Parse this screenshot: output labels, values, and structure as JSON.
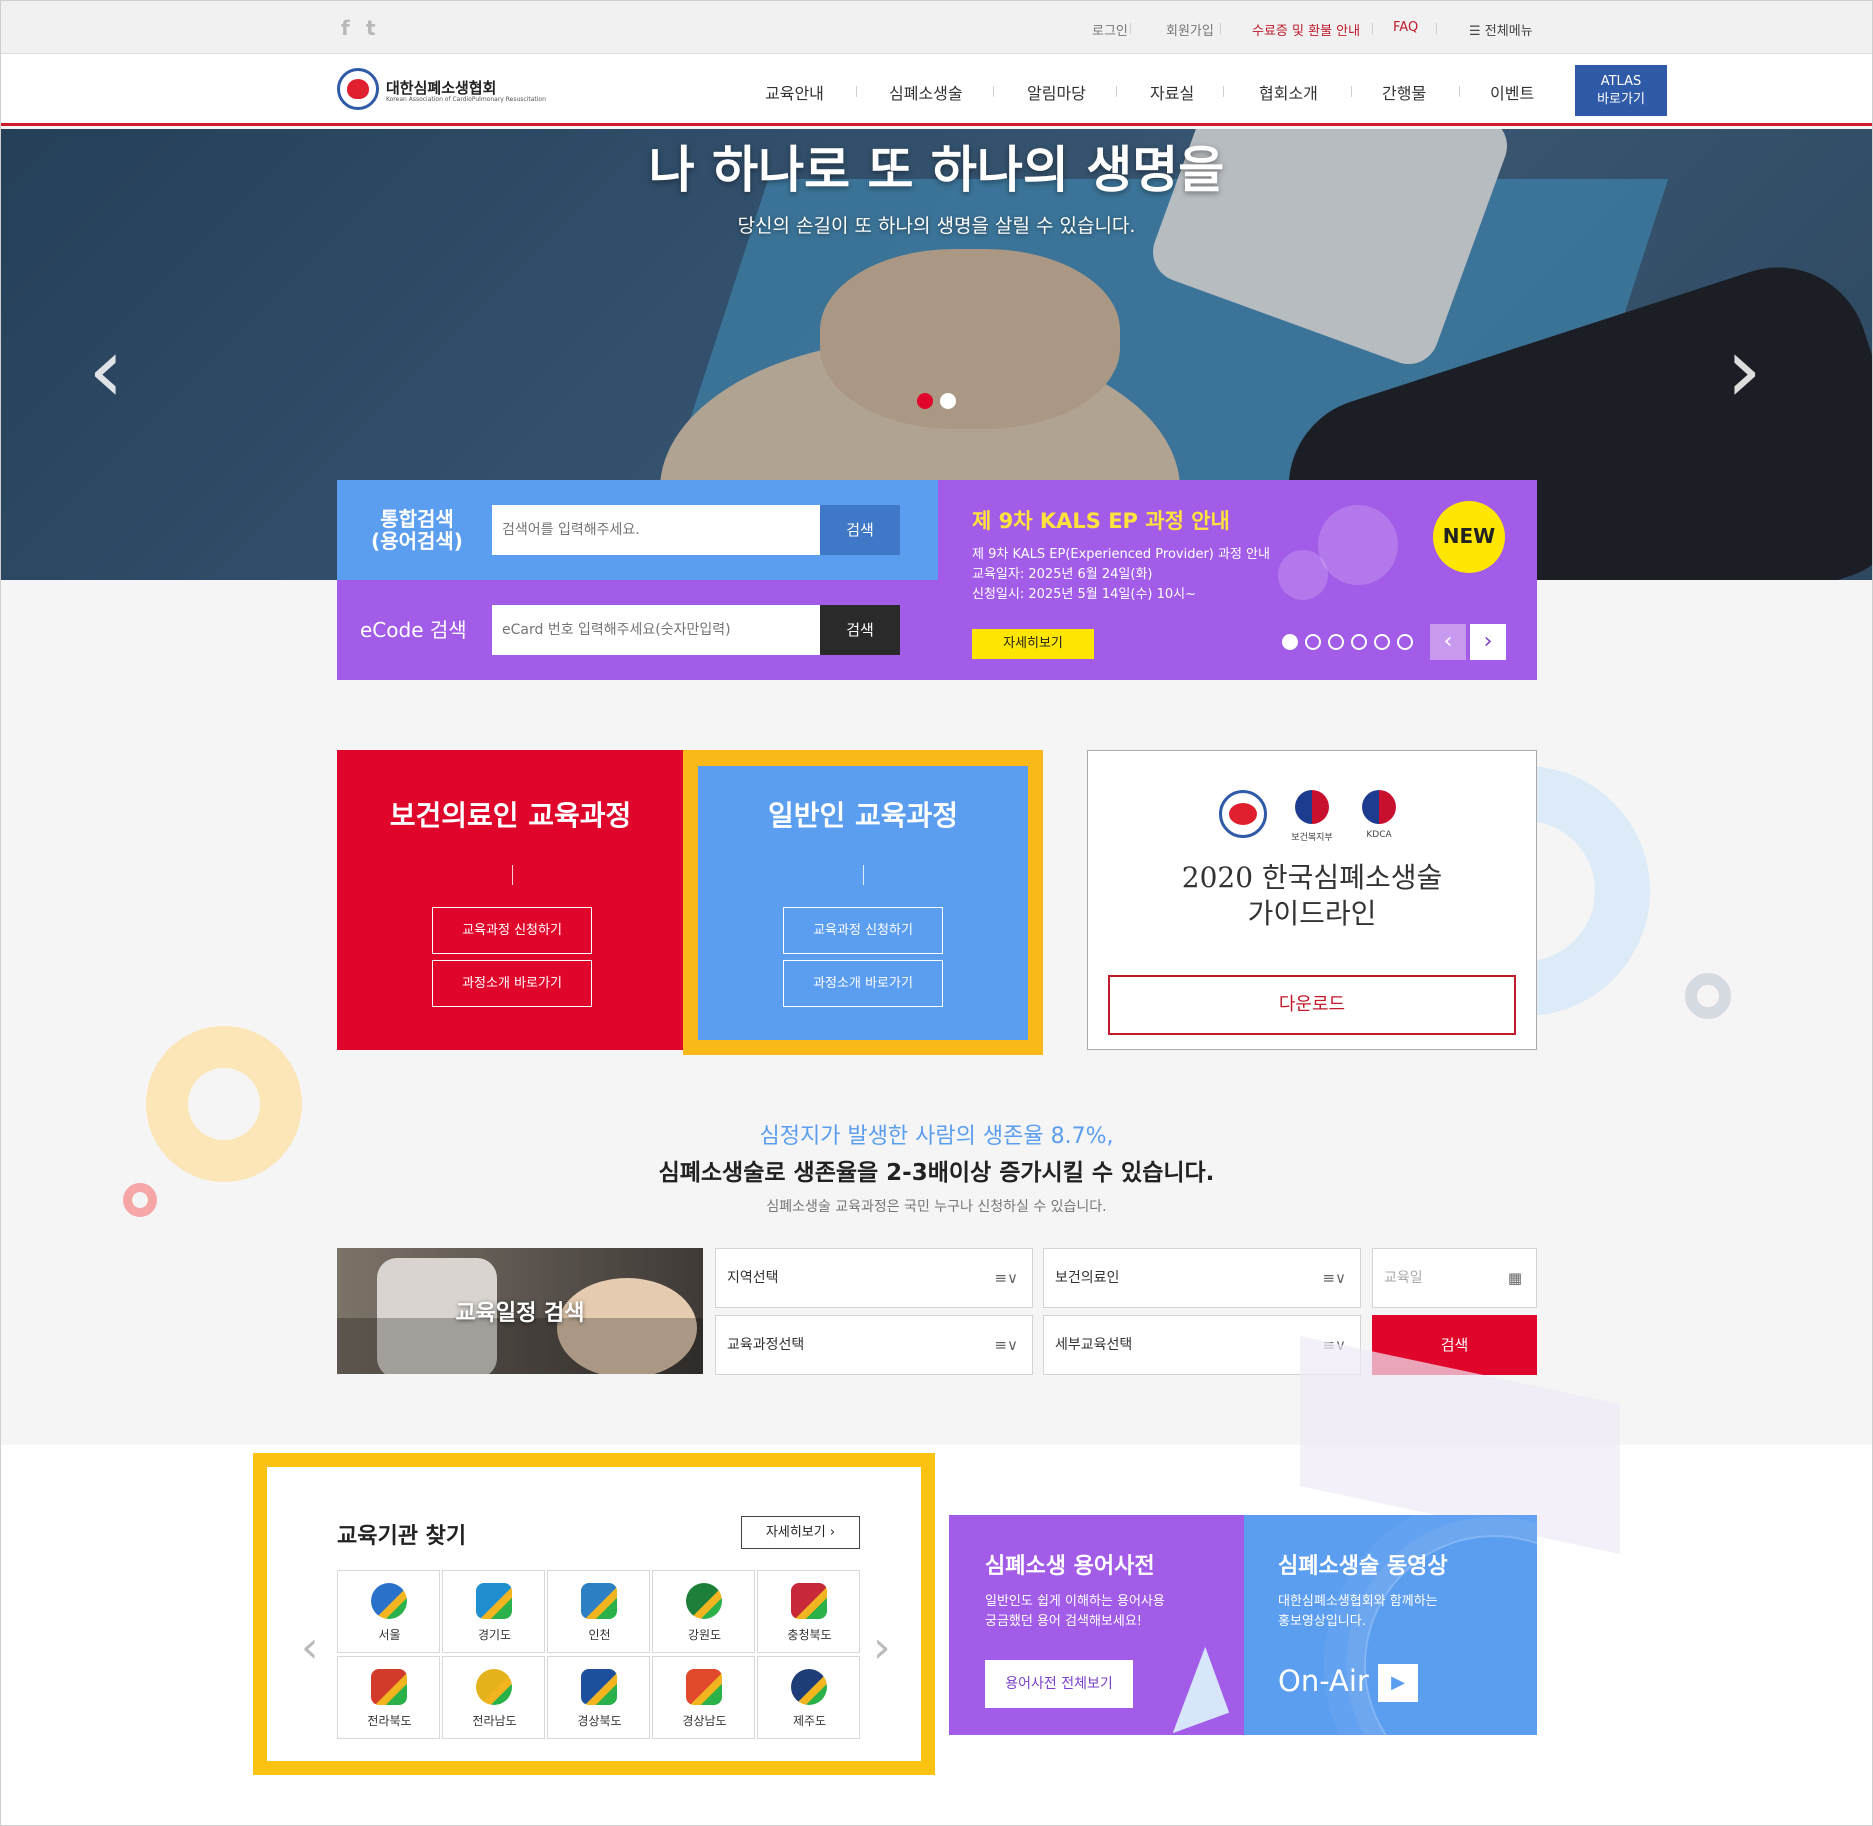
{
  "topbar": {
    "social": [
      "f",
      "t"
    ],
    "links": [
      "로그인",
      "회원가입",
      "수료증 및 환불 안내",
      "FAQ"
    ],
    "menu_label": "☰ 전체메뉴"
  },
  "header": {
    "logo_name": "대한심폐소생협회",
    "logo_sub": "Korean Association of CardioPulmonary Resuscitation",
    "nav": [
      "교육안내",
      "심폐소생술",
      "알림마당",
      "자료실",
      "협회소개",
      "간행물",
      "이벤트"
    ],
    "atlas_line1": "ATLAS",
    "atlas_line2": "바로가기"
  },
  "hero": {
    "title": "나 하나로 또 하나의 생명을",
    "subtitle": "당신의 손길이 또 하나의 생명을 살릴 수 있습니다.",
    "prev_icon": "chevron-left-icon",
    "next_icon": "chevron-right-icon",
    "slide_count": 2,
    "active_slide": 1
  },
  "search": {
    "integrated_label_1": "통합검색",
    "integrated_label_2": "(용어검색)",
    "integrated_placeholder": "검색어를 입력해주세요.",
    "ecode_label": "eCode 검색",
    "ecode_placeholder": "eCard 번호 입력해주세요(숫자만입력)",
    "button_label": "검색"
  },
  "notice": {
    "title": "제 9차 KALS EP 과정 안내",
    "line1": "제 9차 KALS EP(Experienced Provider) 과정 안내",
    "line2": "교육일자: 2025년 6월 24일(화)",
    "line3": "신청일시: 2025년 5월 14일(수) 10시~",
    "detail_button": "자세히보기",
    "badge": "NEW",
    "page_count": 6,
    "active_page": 1,
    "prev": "‹",
    "next": "›"
  },
  "courses": {
    "professional_title": "보건의료인 교육과정",
    "general_title": "일반인 교육과정",
    "apply_button": "교육과정 신청하기",
    "intro_button": "과정소개 바로가기"
  },
  "guideline": {
    "logo_labels": [
      "보건복지부",
      "KDCA"
    ],
    "title_line1": "2020 한국심폐소생술",
    "title_line2": "가이드라인",
    "download_button": "다운로드"
  },
  "survival": {
    "line1": "심정지가 발생한 사람의 생존율 8.7%,",
    "line2": "심폐소생술로 생존율을 2-3배이상 증가시킬 수 있습니다.",
    "line3": "심폐소생술 교육과정은 국민 누구나 신청하실 수 있습니다."
  },
  "schedule": {
    "label": "교육일정 검색",
    "region_select": "지역선택",
    "target_select": "보건의료인",
    "date_placeholder": "교육일",
    "course_select": "교육과정선택",
    "detail_select": "세부교육선택",
    "search_button": "검색",
    "select_icon": "list-filter-icon",
    "calendar_icon": "calendar-icon"
  },
  "institutions": {
    "title": "교육기관 찾기",
    "more_button": "자세히보기  ›",
    "regions": [
      {
        "name": "서울",
        "color": "#2a72c9"
      },
      {
        "name": "경기도",
        "color": "#1f8fd0"
      },
      {
        "name": "인천",
        "color": "#2d7fc4"
      },
      {
        "name": "강원도",
        "color": "#1d7f3a"
      },
      {
        "name": "충청북도",
        "color": "#c8293a"
      },
      {
        "name": "전라북도",
        "color": "#d23a2a"
      },
      {
        "name": "전라남도",
        "color": "#e4b21a"
      },
      {
        "name": "경상북도",
        "color": "#1d4f9c"
      },
      {
        "name": "경상남도",
        "color": "#e0492a"
      },
      {
        "name": "제주도",
        "color": "#1e3d78"
      }
    ],
    "prev": "‹",
    "next": "›"
  },
  "dictionary": {
    "title": "심폐소생 용어사전",
    "desc1": "일반인도 쉽게 이해하는 용어사용",
    "desc2": "궁금했던 용어 검색해보세요!",
    "button": "용어사전 전체보기"
  },
  "video": {
    "title": "심폐소생술 동영상",
    "desc1": "대한심폐소생협회와 함께하는",
    "desc2": "홍보영상입니다.",
    "onair": "On-Air",
    "play": "▶"
  },
  "colors": {
    "red": "#e0052b",
    "blue": "#5b9ef0",
    "purple": "#a35ce8",
    "yellow": "#fbc30f",
    "navy": "#2f5aa8"
  }
}
